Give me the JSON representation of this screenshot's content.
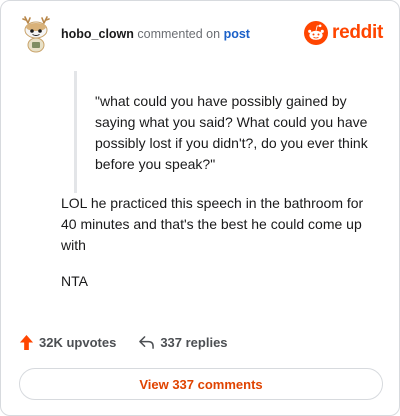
{
  "header": {
    "username": "hobo_clown",
    "action_text": "commented on",
    "post_link": "post",
    "avatar_icon": "snoo-avatar-icon",
    "logo": {
      "icon": "reddit-alien-icon",
      "wordmark": "reddit",
      "color": "#ff4500"
    }
  },
  "comment": {
    "quote": "\"what could you have possibly gained by saying what you said? What could you have possibly lost if you didn't?, do you ever think before you speak?\"",
    "body": "LOL he practiced this speech in the bathroom for 40 minutes and that's the best he could come up with",
    "verdict": "NTA"
  },
  "actions": {
    "upvotes": "32K upvotes",
    "upvote_icon": "upvote-arrow-icon",
    "upvote_color": "#ff4500",
    "replies": "337 replies",
    "reply_icon": "reply-arrow-icon"
  },
  "footer": {
    "view_comments_label": "View 337 comments",
    "accent_color": "#e04300"
  }
}
